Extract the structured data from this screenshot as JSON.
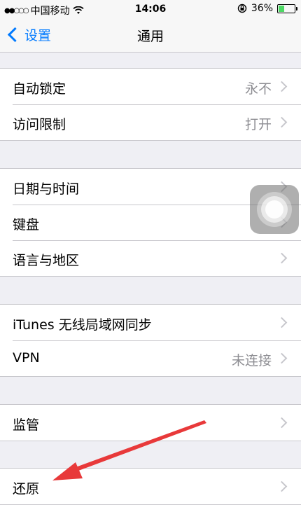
{
  "status_bar": {
    "carrier": "中国移动",
    "time": "14:06",
    "battery_percent_text": "36%",
    "battery_level": 0.36
  },
  "nav": {
    "back_label": "设置",
    "title": "通用"
  },
  "groups": [
    {
      "rows": [
        {
          "label": "自动锁定",
          "value": "永不"
        },
        {
          "label": "访问限制",
          "value": "打开"
        }
      ]
    },
    {
      "rows": [
        {
          "label": "日期与时间"
        },
        {
          "label": "键盘"
        },
        {
          "label": "语言与地区"
        }
      ]
    },
    {
      "rows": [
        {
          "label": "iTunes 无线局域网同步"
        },
        {
          "label": "VPN",
          "value": "未连接"
        }
      ]
    },
    {
      "rows": [
        {
          "label": "监管"
        }
      ]
    },
    {
      "rows": [
        {
          "label": "还原"
        }
      ]
    }
  ],
  "colors": {
    "accent": "#007aff",
    "background": "#efeff4",
    "annotation": "#e8393a"
  }
}
